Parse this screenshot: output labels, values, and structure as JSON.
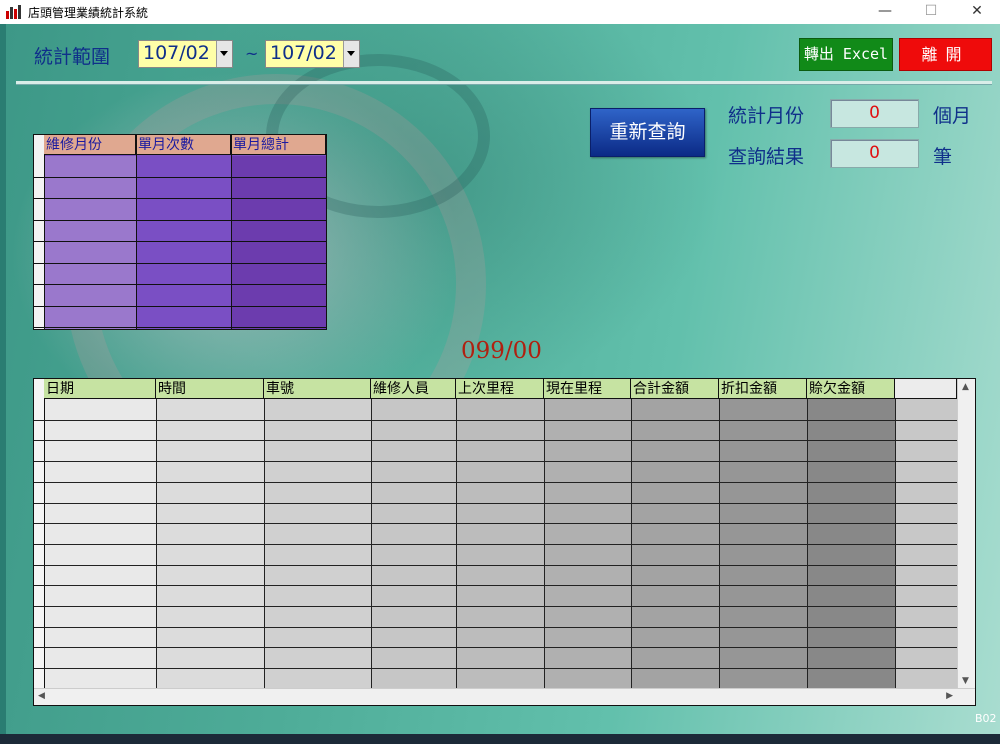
{
  "window": {
    "title": "店頭管理業績統計系統",
    "controls": {
      "minimize": "—",
      "maximize": "☐",
      "close": "✕"
    }
  },
  "toolbar": {
    "range_label": "統計範圍",
    "start_value": "107/02",
    "separator": "~",
    "end_value": "107/02",
    "export_label": "轉出 Excel",
    "exit_label": "離開",
    "export_color": "#118a18",
    "exit_color": "#ef0b0b"
  },
  "summary": {
    "requery_label": "重新查詢",
    "months_label": "統計月份",
    "months_value": "0",
    "months_unit": "個月",
    "results_label": "查詢結果",
    "results_value": "0",
    "results_unit": "筆"
  },
  "monthly_grid": {
    "columns": [
      "維修月份",
      "單月次數",
      "單月總計"
    ],
    "rows": 8
  },
  "center_text": "099/00",
  "detail_grid": {
    "columns": [
      "日期",
      "時間",
      "車號",
      "維修人員",
      "上次里程",
      "現在里程",
      "合計金額",
      "折扣金額",
      "賒欠金額"
    ],
    "rows": 14
  },
  "footer": {
    "corner_label": "B02"
  }
}
